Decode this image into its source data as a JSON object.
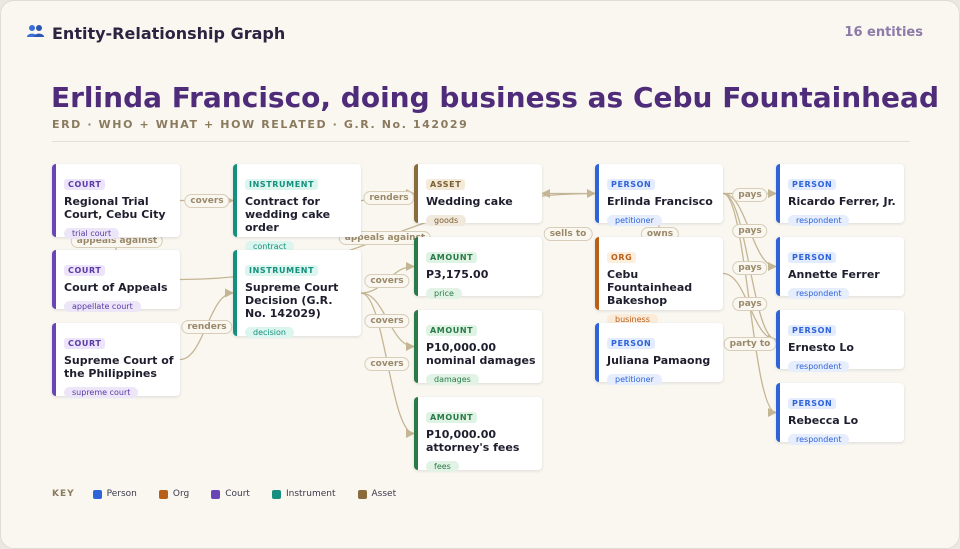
{
  "header": {
    "icon": "people-icon",
    "title": "Entity-Relationship Graph",
    "count": "16 entities"
  },
  "title": "Erlinda Francisco, doing business as Cebu Fountainhead",
  "subtitle": "ERD · WHO + WHAT + HOW RELATED · G.R. No. 142029",
  "colors": {
    "person": "#2f64d8",
    "org": "#b85f1a",
    "court": "#6a45b6",
    "instrument": "#15907e",
    "asset": "#8a6c3c",
    "amount": "#2a7a48",
    "edge": "#c4b594"
  },
  "nodes": [
    {
      "id": "rtc",
      "kind": "court",
      "type": "COURT",
      "name": "Regional Trial Court, Cebu City",
      "role": "trial court"
    },
    {
      "id": "ca",
      "kind": "court",
      "type": "COURT",
      "name": "Court of Appeals",
      "role": "appellate court"
    },
    {
      "id": "sc",
      "kind": "court",
      "type": "COURT",
      "name": "Supreme Court of the Philippines",
      "role": "supreme court"
    },
    {
      "id": "contract",
      "kind": "instrument",
      "type": "INSTRUMENT",
      "name": "Contract for wedding cake order",
      "role": "contract"
    },
    {
      "id": "decision",
      "kind": "instrument",
      "type": "INSTRUMENT",
      "name": "Supreme Court Decision (G.R. No. 142029)",
      "role": "decision"
    },
    {
      "id": "cake",
      "kind": "asset",
      "type": "ASSET",
      "name": "Wedding cake",
      "role": "goods"
    },
    {
      "id": "price",
      "kind": "amount",
      "type": "AMOUNT",
      "name": "P3,175.00",
      "role": "price"
    },
    {
      "id": "nominal",
      "kind": "amount",
      "type": "AMOUNT",
      "name": "P10,000.00 nominal damages",
      "role": "damages"
    },
    {
      "id": "fees",
      "kind": "amount",
      "type": "AMOUNT",
      "name": "P10,000.00 attorney's fees",
      "role": "fees"
    },
    {
      "id": "erlinda",
      "kind": "person",
      "type": "PERSON",
      "name": "Erlinda Francisco",
      "role": "petitioner"
    },
    {
      "id": "bakeshop",
      "kind": "org",
      "type": "ORG",
      "name": "Cebu Fountainhead Bakeshop",
      "role": "business"
    },
    {
      "id": "juliana",
      "kind": "person",
      "type": "PERSON",
      "name": "Juliana Pamaong",
      "role": "petitioner"
    },
    {
      "id": "ricardo",
      "kind": "person",
      "type": "PERSON",
      "name": "Ricardo Ferrer, Jr.",
      "role": "respondent"
    },
    {
      "id": "annette",
      "kind": "person",
      "type": "PERSON",
      "name": "Annette Ferrer",
      "role": "respondent"
    },
    {
      "id": "ernesto",
      "kind": "person",
      "type": "PERSON",
      "name": "Ernesto Lo",
      "role": "respondent"
    },
    {
      "id": "rebecca",
      "kind": "person",
      "type": "PERSON",
      "name": "Rebecca Lo",
      "role": "respondent"
    }
  ],
  "edges": [
    {
      "from": "rtc",
      "to": "contract",
      "label": "covers"
    },
    {
      "from": "contract",
      "to": "cake",
      "label": "renders"
    },
    {
      "from": "ca",
      "to": "rtc",
      "label": "appeals against"
    },
    {
      "from": "ca",
      "to": "erlinda",
      "label": "appeals against"
    },
    {
      "from": "sc",
      "to": "decision",
      "label": "renders"
    },
    {
      "from": "decision",
      "to": "price",
      "label": "covers"
    },
    {
      "from": "decision",
      "to": "nominal",
      "label": "covers"
    },
    {
      "from": "decision",
      "to": "fees",
      "label": "covers"
    },
    {
      "from": "erlinda",
      "to": "cake",
      "label": "sells to"
    },
    {
      "from": "erlinda",
      "to": "bakeshop",
      "label": "owns"
    },
    {
      "from": "erlinda",
      "to": "ricardo",
      "label": "pays"
    },
    {
      "from": "erlinda",
      "to": "annette",
      "label": "pays"
    },
    {
      "from": "erlinda",
      "to": "ernesto",
      "label": "pays"
    },
    {
      "from": "erlinda",
      "to": "rebecca",
      "label": "pays"
    },
    {
      "from": "bakeshop",
      "to": "ernesto",
      "label": "party to"
    }
  ],
  "key": {
    "label": "KEY",
    "items": [
      {
        "kind": "person",
        "label": "Person"
      },
      {
        "kind": "org",
        "label": "Org"
      },
      {
        "kind": "court",
        "label": "Court"
      },
      {
        "kind": "instrument",
        "label": "Instrument"
      },
      {
        "kind": "asset",
        "label": "Asset"
      }
    ]
  }
}
